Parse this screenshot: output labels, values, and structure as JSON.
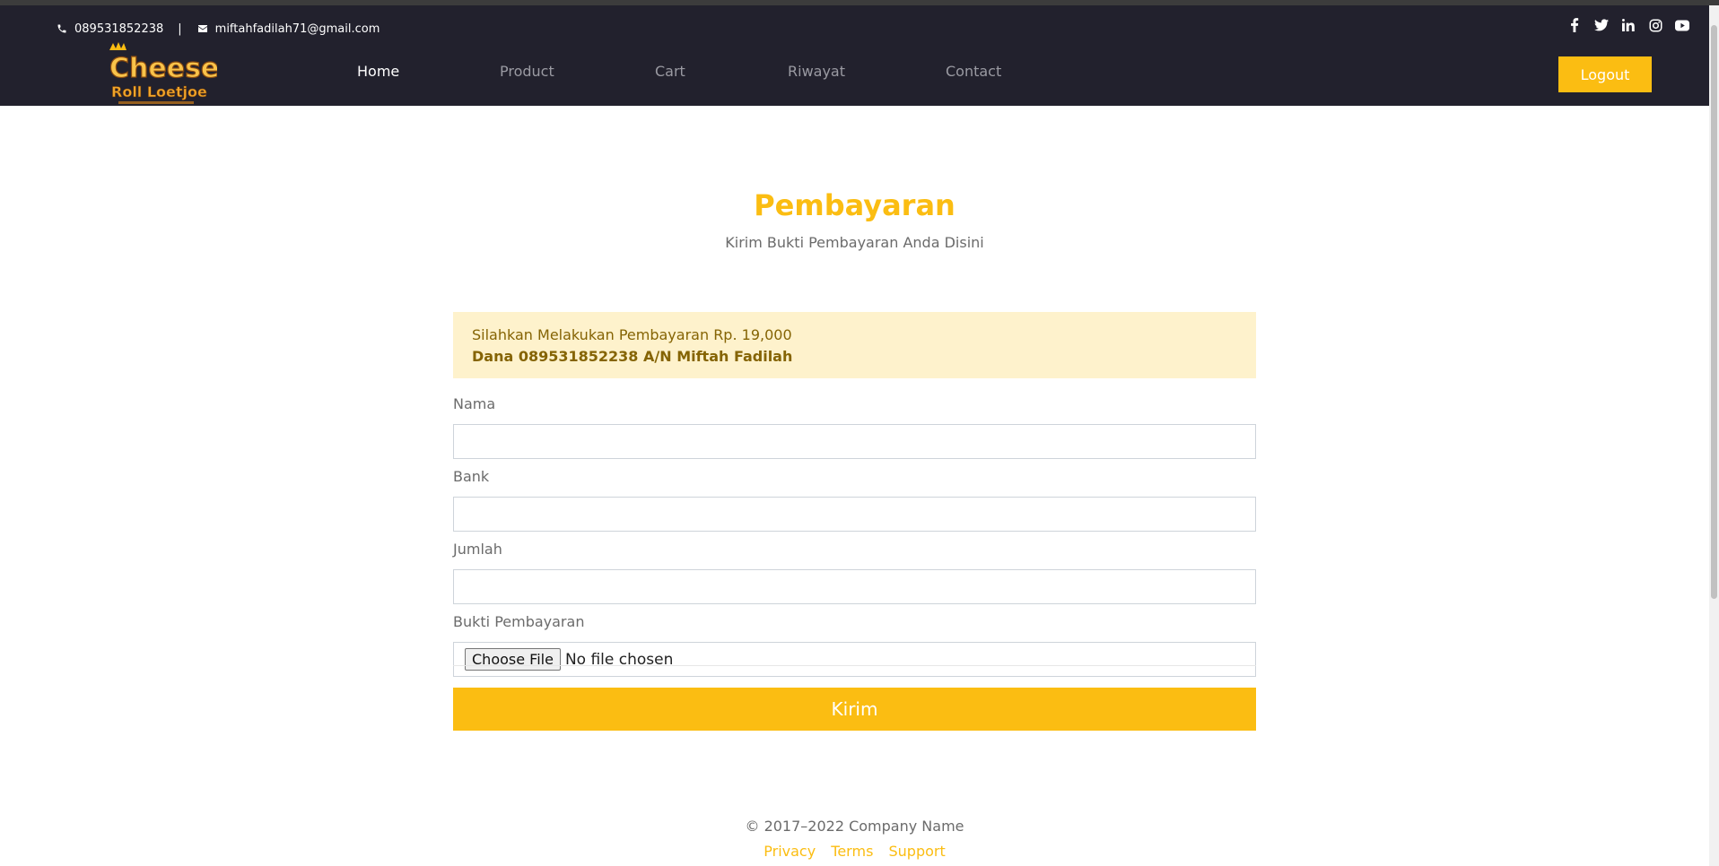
{
  "header": {
    "phone": "089531852238",
    "separator": "|",
    "email": "miftahfadilah71@gmail.com",
    "socials": [
      "facebook-icon",
      "twitter-icon",
      "linkedin-icon",
      "instagram-icon",
      "youtube-icon"
    ],
    "logo": {
      "line1": "Cheese",
      "line2": "Roll Loetjoe"
    },
    "nav": [
      {
        "label": "Home",
        "active": true
      },
      {
        "label": "Product",
        "active": false
      },
      {
        "label": "Cart",
        "active": false
      },
      {
        "label": "Riwayat",
        "active": false
      },
      {
        "label": "Contact",
        "active": false
      }
    ],
    "logout_label": "Logout"
  },
  "main": {
    "title": "Pembayaran",
    "subtitle": "Kirim Bukti Pembayaran Anda Disini",
    "alert": {
      "line1": "Silahkan Melakukan Pembayaran Rp. 19,000",
      "line2": "Dana 089531852238 A/N Miftah Fadilah"
    },
    "form": {
      "fields": [
        {
          "label": "Nama",
          "value": ""
        },
        {
          "label": "Bank",
          "value": ""
        },
        {
          "label": "Jumlah",
          "value": ""
        }
      ],
      "file": {
        "label": "Bukti Pembayaran",
        "button": "Choose File",
        "status": "No file chosen"
      },
      "submit_label": "Kirim"
    }
  },
  "footer": {
    "copyright": "© 2017–2022 Company Name",
    "links": [
      "Privacy",
      "Terms",
      "Support"
    ]
  },
  "colors": {
    "accent": "#fbbd12",
    "header_bg": "#22212d",
    "alert_bg": "#fef2cc",
    "alert_text": "#856404"
  }
}
